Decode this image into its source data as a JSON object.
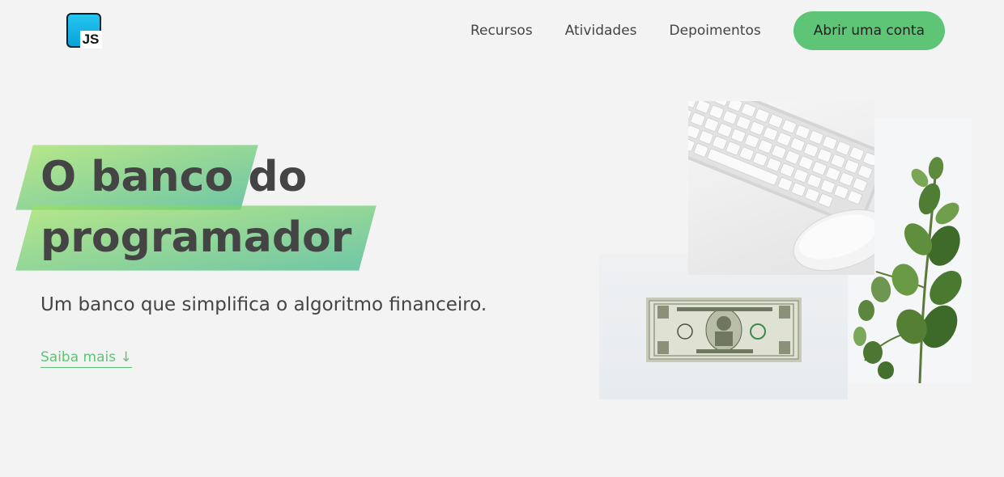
{
  "logo": {
    "text": "JS"
  },
  "nav": {
    "items": [
      {
        "label": "Recursos"
      },
      {
        "label": "Atividades"
      },
      {
        "label": "Depoimentos"
      }
    ],
    "cta_label": "Abrir uma conta"
  },
  "hero": {
    "headline_highlight_1": "O banco",
    "headline_plain": "do",
    "headline_highlight_2": "programador",
    "subtitle": "Um banco que simplifica o algoritmo financeiro.",
    "learn_more": "Saiba mais ↓"
  },
  "images": [
    {
      "icon": "keyboard-mouse-photo"
    },
    {
      "icon": "plant-photo"
    },
    {
      "icon": "dollar-bill-photo"
    }
  ],
  "colors": {
    "background": "#f3f3f3",
    "accent": "#5ec576",
    "text": "#444444",
    "highlight_gradient_start": "#9be15d",
    "highlight_gradient_end": "#39b385"
  }
}
